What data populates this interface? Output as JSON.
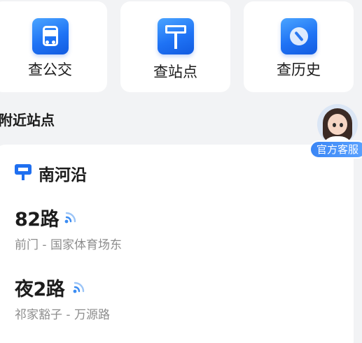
{
  "quick_actions": [
    {
      "label": "查公交",
      "icon": "bus-icon"
    },
    {
      "label": "查站点",
      "icon": "bus-stop-sign-icon"
    },
    {
      "label": "查历史",
      "icon": "history-compass-icon"
    }
  ],
  "nearby": {
    "title": "附近站点",
    "station": {
      "icon": "bus-stop-icon",
      "name": "南河沿",
      "routes": [
        {
          "name": "82路",
          "direction": "前门 - 国家体育场东",
          "icon": "realtime-signal-icon"
        },
        {
          "name": "夜2路",
          "direction": "祁家豁子 - 万源路",
          "icon": "realtime-signal-icon"
        }
      ]
    }
  },
  "customer_service": {
    "label": "官方客服",
    "icon": "customer-service-avatar"
  },
  "colors": {
    "accent": "#1f6ff0",
    "background": "#f2f3f5",
    "card": "#ffffff",
    "secondary_text": "#8d8d8d"
  }
}
